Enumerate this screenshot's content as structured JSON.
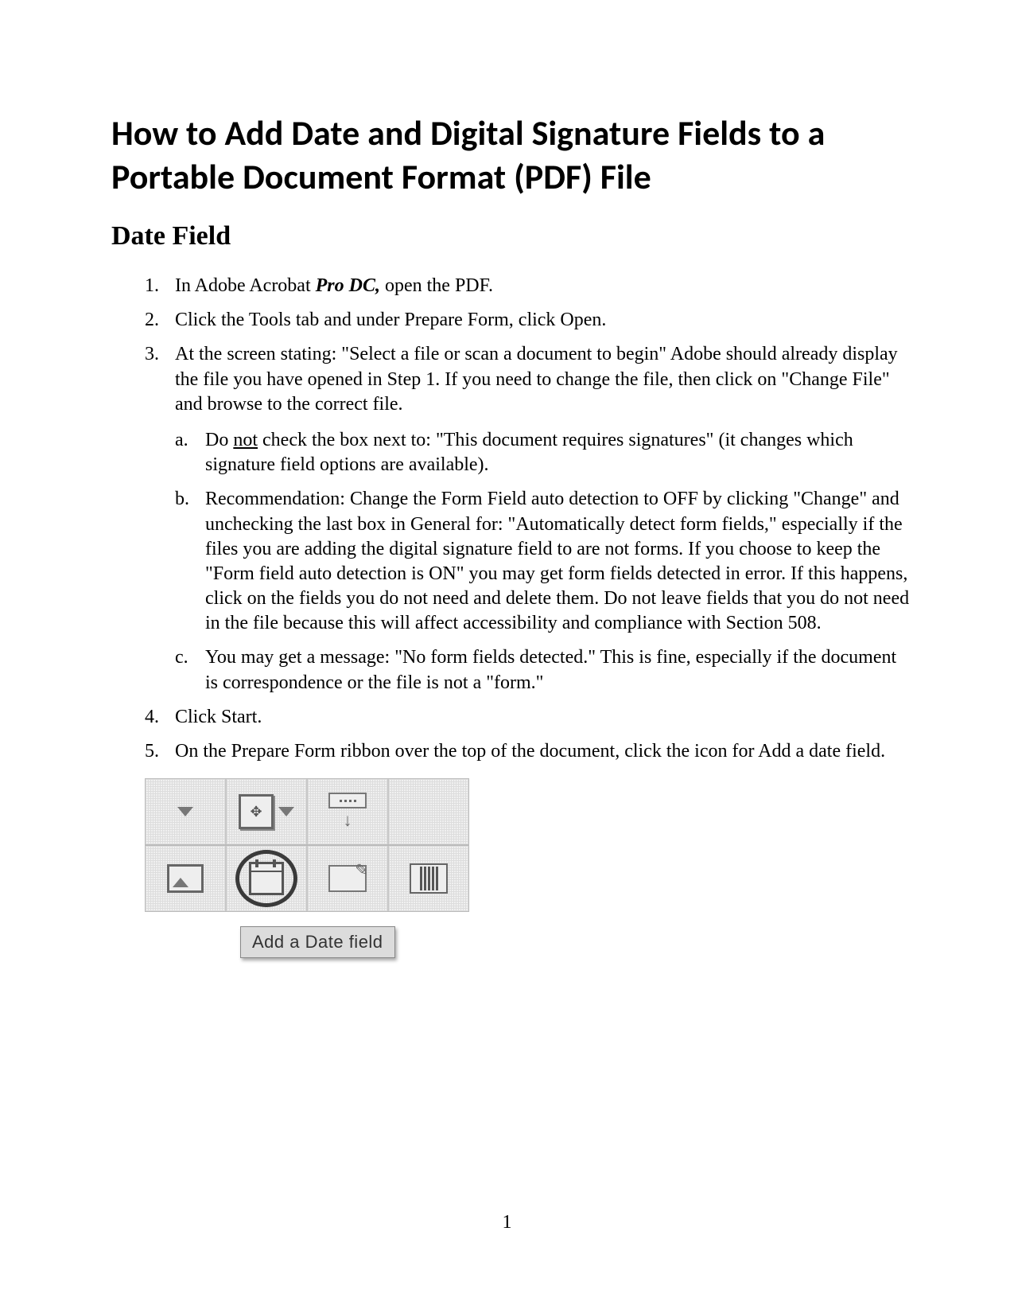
{
  "title": "How to Add Date and Digital Signature Fields to a Portable Document Format (PDF) File",
  "section_heading": "Date Field",
  "steps": {
    "s1_pre": "In Adobe Acrobat ",
    "s1_bold": "Pro DC,",
    "s1_post": " open the PDF.",
    "s2": "Click the Tools tab and under Prepare Form, click Open.",
    "s3": "At the screen stating: \"Select a file or scan a document to begin\" Adobe should already display the file you have opened in Step 1.  If you need to change the file, then click on \"Change File\" and browse to the correct file.",
    "s3a_pre": "Do ",
    "s3a_underline": "not",
    "s3a_post": " check the box next to: \"This document requires signatures\" (it changes which signature field options are available).",
    "s3b": "Recommendation:  Change the Form Field auto detection to OFF by clicking \"Change\" and unchecking the last box in General for: \"Automatically detect form fields,\" especially if the files you are adding the digital signature field to are not forms.  If you choose to keep the \"Form field auto detection is ON\" you may get form fields detected in error.  If this happens, click on the fields you do not need and delete them.  Do not leave fields that you do not need in the file because this will affect accessibility and compliance with Section 508.",
    "s3c": "You may get a message: \"No form fields detected.\"  This is fine, especially if the document is correspondence or the file is not a \"form.\"",
    "s4": "Click Start.",
    "s5": "On the Prepare Form ribbon over the top of the document, click the icon for Add a date field."
  },
  "markers": {
    "n1": "1.",
    "n2": "2.",
    "n3": "3.",
    "n4": "4.",
    "n5": "5.",
    "a": "a.",
    "b": "b.",
    "c": "c."
  },
  "ribbon": {
    "tooltip": "Add a Date field"
  },
  "page_number": "1"
}
